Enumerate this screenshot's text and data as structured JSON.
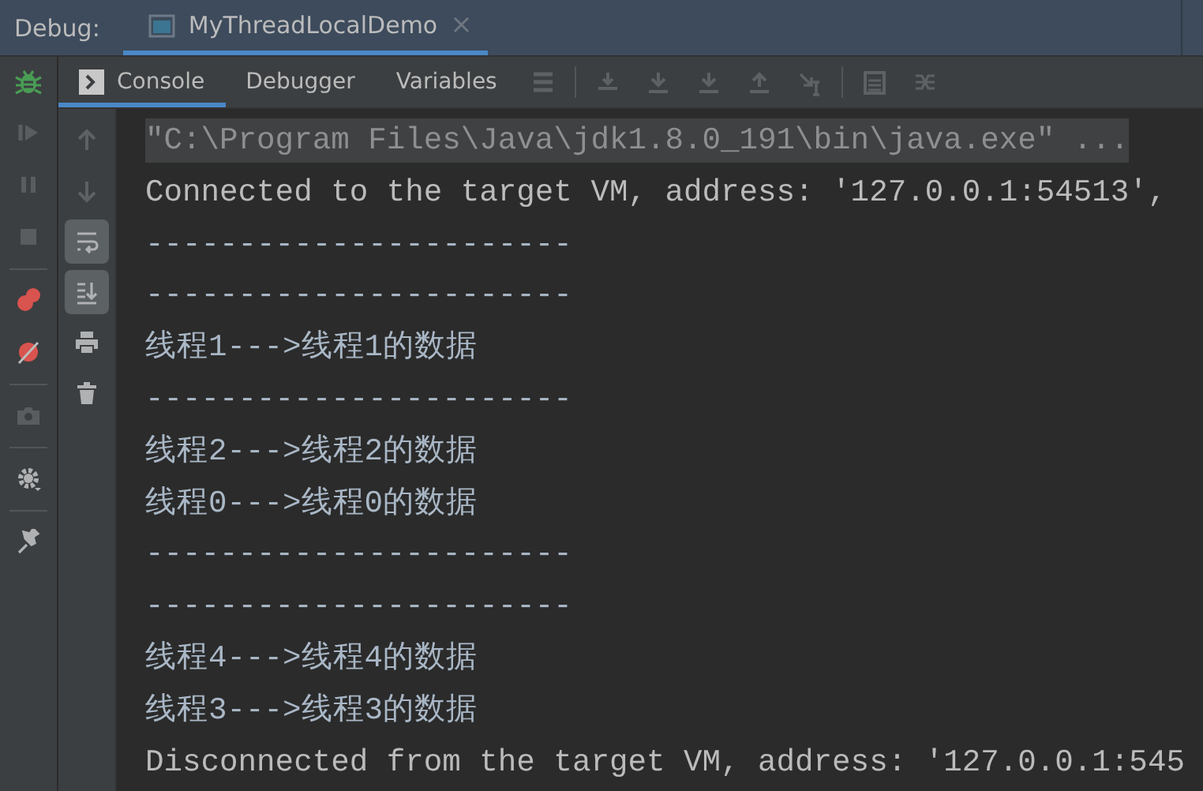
{
  "header": {
    "label": "Debug:",
    "tabs": [
      {
        "title": "MyThreadLocalDemo",
        "selected": true,
        "close": "×"
      }
    ]
  },
  "toolbar": {
    "tabs": [
      {
        "label": "Console",
        "selected": true
      },
      {
        "label": "Debugger",
        "selected": false
      },
      {
        "label": "Variables",
        "selected": false
      }
    ],
    "actions": [
      {
        "kind": "layout"
      },
      {
        "kind": "sep"
      },
      {
        "kind": "step-over"
      },
      {
        "kind": "step-into"
      },
      {
        "kind": "force-step"
      },
      {
        "kind": "step-out"
      },
      {
        "kind": "cursor"
      },
      {
        "kind": "sep"
      },
      {
        "kind": "calc"
      },
      {
        "kind": "trace"
      }
    ]
  },
  "debug_tools": [
    {
      "kind": "resume",
      "disabled": true
    },
    {
      "kind": "pause",
      "disabled": true
    },
    {
      "kind": "stop",
      "disabled": true
    },
    {
      "kind": "sep"
    },
    {
      "kind": "breakpoints",
      "disabled": false
    },
    {
      "kind": "mute",
      "disabled": false
    },
    {
      "kind": "sep"
    },
    {
      "kind": "camera",
      "disabled": true
    },
    {
      "kind": "sep"
    },
    {
      "kind": "settings",
      "disabled": false
    },
    {
      "kind": "sep"
    },
    {
      "kind": "pin",
      "disabled": false
    }
  ],
  "console_tools": [
    {
      "kind": "up",
      "on": false
    },
    {
      "kind": "down",
      "on": false
    },
    {
      "kind": "wrap",
      "on": true
    },
    {
      "kind": "scroll-end",
      "on": true
    },
    {
      "kind": "print",
      "on": false
    },
    {
      "kind": "trash",
      "on": false
    }
  ],
  "console": {
    "lines": [
      {
        "kind": "command",
        "text": "\"C:\\Program Files\\Java\\jdk1.8.0_191\\bin\\java.exe\" ..."
      },
      {
        "kind": "system",
        "text": "Connected to the target VM, address: '127.0.0.1:54513',"
      },
      {
        "kind": "output",
        "text": "-----------------------"
      },
      {
        "kind": "output",
        "text": "-----------------------"
      },
      {
        "kind": "output",
        "text": "线程1--->线程1的数据"
      },
      {
        "kind": "output",
        "text": "-----------------------"
      },
      {
        "kind": "output",
        "text": "线程2--->线程2的数据"
      },
      {
        "kind": "output",
        "text": "线程0--->线程0的数据"
      },
      {
        "kind": "output",
        "text": "-----------------------"
      },
      {
        "kind": "output",
        "text": "-----------------------"
      },
      {
        "kind": "output",
        "text": "线程4--->线程4的数据"
      },
      {
        "kind": "output",
        "text": "线程3--->线程3的数据"
      },
      {
        "kind": "system",
        "text": "Disconnected from the target VM, address: '127.0.0.1:545"
      }
    ]
  }
}
